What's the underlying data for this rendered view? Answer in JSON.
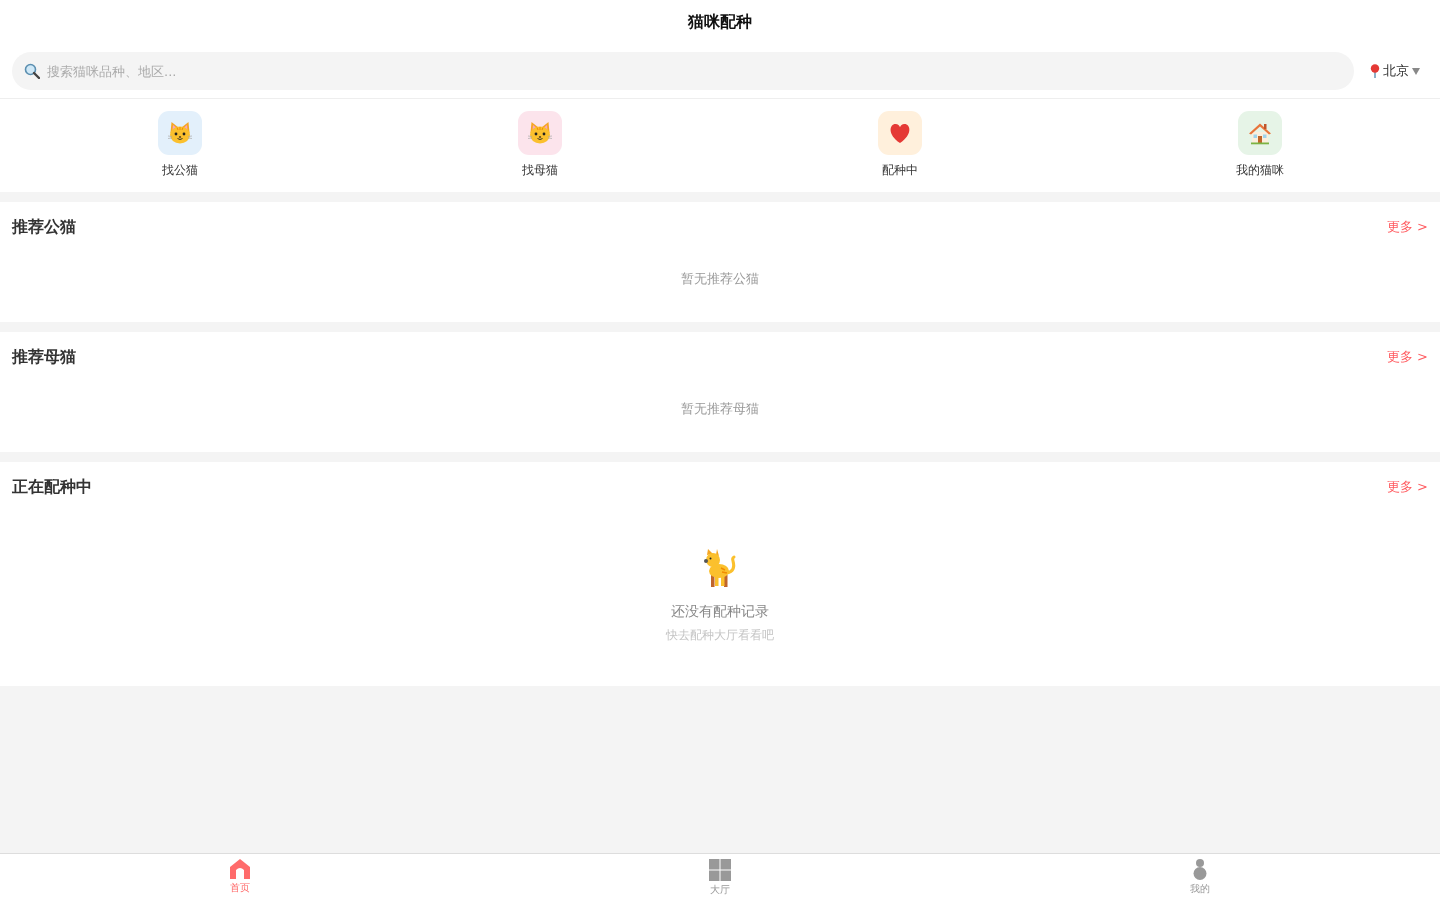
{
  "header": {
    "title": "猫咪配种"
  },
  "search": {
    "placeholder": "搜索猫咪品种、地区..."
  },
  "location": {
    "city": "北京"
  },
  "categories": [
    {
      "label": "找公猫",
      "kind": "cat",
      "color": "#e3f0fb"
    },
    {
      "label": "找母猫",
      "kind": "cat",
      "color": "#fce4ec"
    },
    {
      "label": "配种中",
      "kind": "heart",
      "color": "#fff0dc"
    },
    {
      "label": "我的猫咪",
      "kind": "house",
      "color": "#e6f4e7"
    }
  ],
  "sections": [
    {
      "title": "推荐公猫",
      "more": "更多 >",
      "empty": {
        "kind": "text",
        "message": "暂无推荐公猫"
      }
    },
    {
      "title": "推荐母猫",
      "more": "更多 >",
      "empty": {
        "kind": "text",
        "message": "暂无推荐母猫"
      }
    },
    {
      "title": "正在配种中",
      "more": "更多 >",
      "empty": {
        "kind": "illustrated",
        "message": "还没有配种记录",
        "hint": "快去配种大厅看看吧"
      }
    }
  ],
  "tab_bar": [
    {
      "label": "首页",
      "kind": "home",
      "selected": true
    },
    {
      "label": "大厅",
      "kind": "grid",
      "selected": false
    },
    {
      "label": "我的",
      "kind": "person",
      "selected": false
    }
  ]
}
